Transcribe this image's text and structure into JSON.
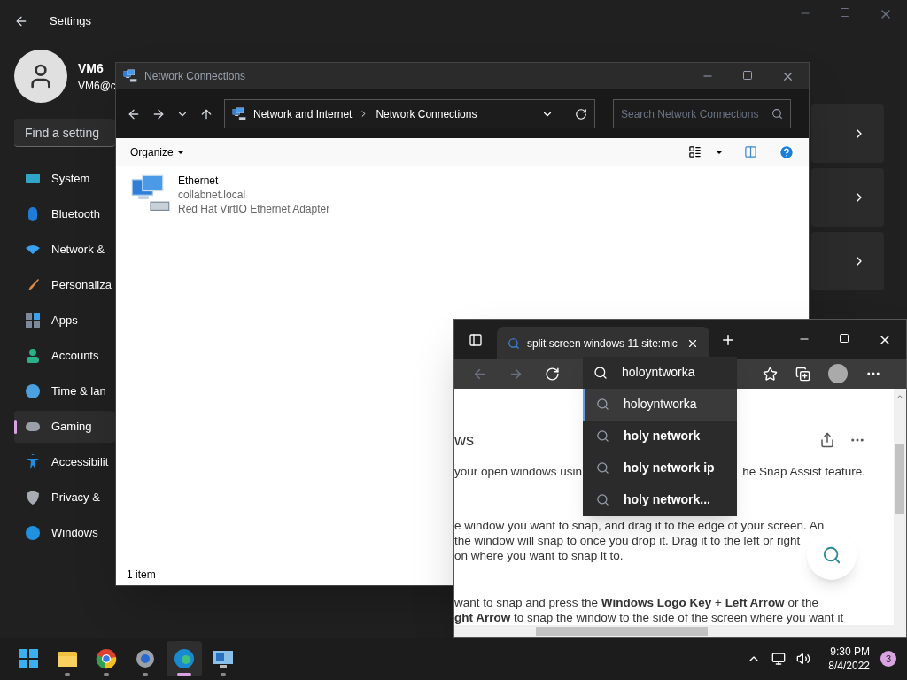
{
  "settings": {
    "title": "Settings",
    "user": {
      "name": "VM6",
      "email": "VM6@c"
    },
    "search": {
      "placeholder": "Find a setting"
    },
    "nav": [
      {
        "label": "System",
        "selected": false
      },
      {
        "label": "Bluetooth",
        "selected": false
      },
      {
        "label": "Network &",
        "selected": false
      },
      {
        "label": "Personaliza",
        "selected": false
      },
      {
        "label": "Apps",
        "selected": false
      },
      {
        "label": "Accounts",
        "selected": false
      },
      {
        "label": "Time & lan",
        "selected": false
      },
      {
        "label": "Gaming",
        "selected": true
      },
      {
        "label": "Accessibilit",
        "selected": false
      },
      {
        "label": "Privacy &",
        "selected": false
      },
      {
        "label": "Windows",
        "selected": false
      }
    ]
  },
  "network_window": {
    "title": "Network Connections",
    "breadcrumb": [
      "Network and Internet",
      "Network Connections"
    ],
    "search": {
      "placeholder": "Search Network Connections"
    },
    "organize": "Organize",
    "items": [
      {
        "name": "Ethernet",
        "lines": [
          "collabnet.local",
          "Red Hat VirtIO Ethernet Adapter"
        ]
      }
    ],
    "status": "1 item"
  },
  "browser": {
    "tab": {
      "title": "split screen windows 11 site:mic",
      "selected": true
    },
    "address": {
      "value": "holoyntworka"
    },
    "suggestions": [
      {
        "text": "holoyntworka",
        "kind": "typed",
        "selected": true
      },
      {
        "text": "holy network",
        "kind": "suggestion",
        "selected": false
      },
      {
        "text": "holy network ip",
        "kind": "suggestion",
        "selected": false
      },
      {
        "text": "holy network...",
        "kind": "suggestion",
        "selected": false
      }
    ],
    "page": {
      "heading": "ws",
      "intro_left": "your open windows usin",
      "intro_right": "he Snap Assist feature.",
      "paragraph_1": [
        "e window you want to snap, and drag it to the edge of your screen. An",
        "the window will snap to once you drop it. Drag it to the left or right",
        "on where you want to snap it to."
      ],
      "paragraph_2": [
        "want to snap and press the **Windows Logo Key** + **Left Arrow** or the",
        "**ght Arrow** to snap the window to the side of the screen where you want it"
      ]
    }
  },
  "taskbar": {
    "apps": [
      {
        "running": false,
        "selected": false
      },
      {
        "running": true,
        "selected": false
      },
      {
        "running": true,
        "selected": false
      },
      {
        "running": true,
        "selected": false
      },
      {
        "running": true,
        "selected": true
      },
      {
        "running": true,
        "selected": false
      }
    ],
    "time": "9:30 PM",
    "date": "8/4/2022",
    "notifications": "3"
  }
}
